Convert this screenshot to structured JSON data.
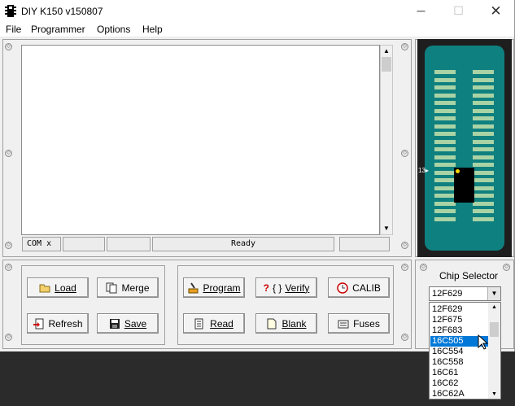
{
  "window": {
    "title": "DIY K150 v150807"
  },
  "menu": [
    "File",
    "Programmer",
    "Options",
    "Help"
  ],
  "status": {
    "com": "COM x",
    "state": "Ready"
  },
  "socket": {
    "pin_label": "13"
  },
  "buttons": {
    "load": "Load",
    "merge": "Merge",
    "refresh": "Refresh",
    "save": "Save",
    "program": "Program",
    "verify": "Verify",
    "calib": "CALIB",
    "read": "Read",
    "blank": "Blank",
    "fuses": "Fuses"
  },
  "chip_selector": {
    "title": "Chip Selector",
    "selected": "12F629",
    "options": [
      "12F629",
      "12F675",
      "12F683",
      "16C505",
      "16C554",
      "16C558",
      "16C61",
      "16C62",
      "16C62A"
    ],
    "highlighted": "16C505"
  },
  "colors": {
    "socket": "#0f8080",
    "pins": "#a9d3a5",
    "selection": "#0078d7"
  }
}
